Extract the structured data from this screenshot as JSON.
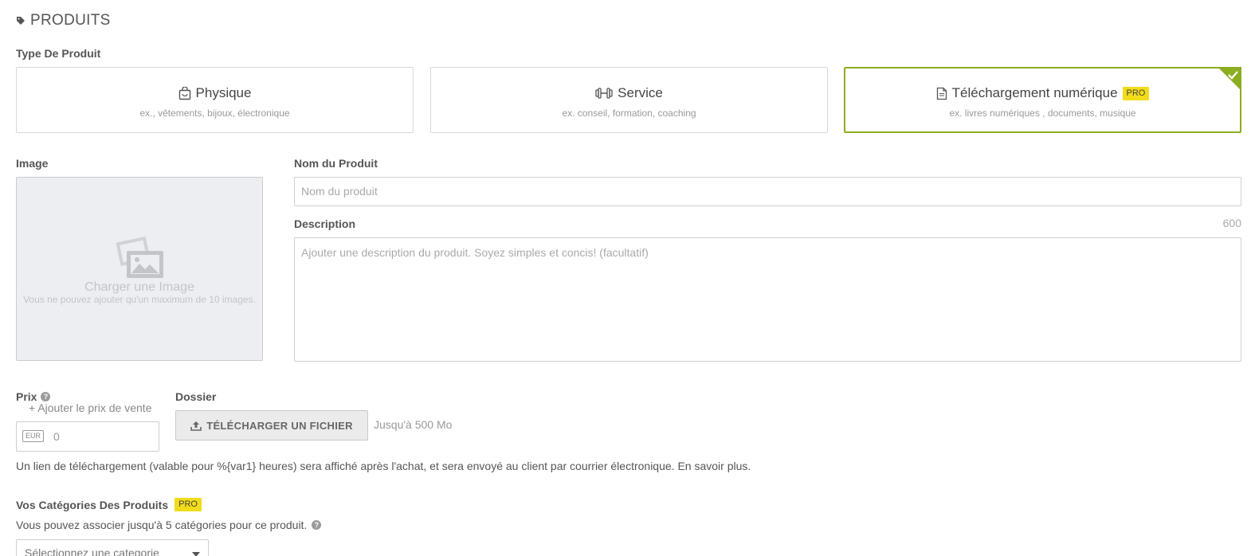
{
  "section": {
    "title": "PRODUITS",
    "icon": "tag-icon"
  },
  "product_type": {
    "label": "Type De Produit",
    "cards": [
      {
        "title": "Physique",
        "subtitle": "ex., vêtements, bijoux, électronique",
        "icon": "shopping-bag-icon",
        "selected": false
      },
      {
        "title": "Service",
        "subtitle": "ex. conseil, formation, coaching",
        "icon": "dumbbell-icon",
        "selected": false
      },
      {
        "title": "Téléchargement numérique",
        "subtitle": "ex. livres numériques , documents, musique",
        "icon": "document-icon",
        "selected": true,
        "badge": "PRO"
      }
    ]
  },
  "image": {
    "label": "Image",
    "upload_title": "Charger une Image",
    "upload_hint": "Vous ne pouvez ajouter qu'un maximum de 10 images."
  },
  "name": {
    "label": "Nom du Produit",
    "placeholder": "Nom du produit",
    "value": ""
  },
  "description": {
    "label": "Description",
    "counter": "600",
    "placeholder": "Ajouter une description du produit. Soyez simples et concis! (facultatif)",
    "value": ""
  },
  "price": {
    "label": "Prix",
    "add_sale_price": "+ Ajouter le prix de vente",
    "currency": "EUR",
    "placeholder": "0"
  },
  "file": {
    "label": "Dossier",
    "upload_button": "TÉLÉCHARGER UN FICHIER",
    "limit": "Jusqu'à 500 Mo"
  },
  "download_info": "Un lien de téléchargement (valable pour %{var1} heures) sera affiché après l'achat, et sera envoyé au client par courrier électronique. En savoir plus.",
  "categories": {
    "label": "Vos Catégories Des Produits",
    "badge": "PRO",
    "help": "Vous pouvez associer jusqu'à 5 catégories pour ce produit.",
    "select_placeholder": "Sélectionnez une categorie"
  },
  "colors": {
    "accent": "#8aae1f",
    "pro_badge": "#f2dc1a"
  }
}
